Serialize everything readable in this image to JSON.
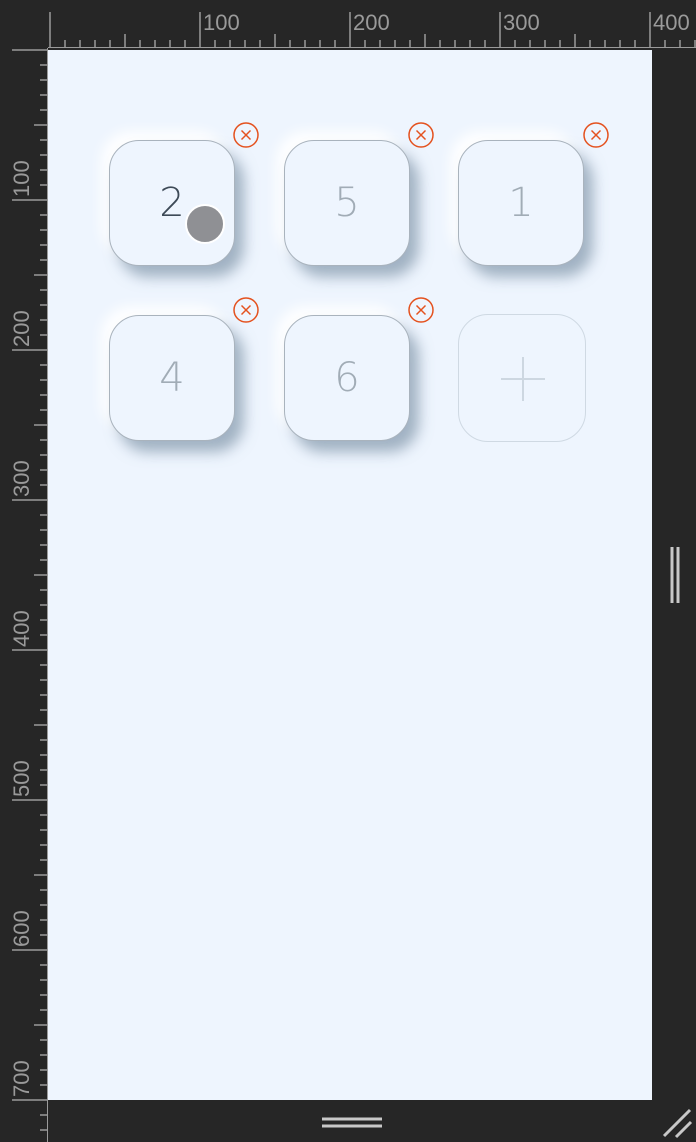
{
  "ruler": {
    "top_labels": [
      "100",
      "200",
      "300",
      "400"
    ],
    "left_labels": [
      "100",
      "200",
      "300",
      "400",
      "500",
      "600",
      "700"
    ]
  },
  "tiles": [
    {
      "number": "2",
      "removable": true,
      "active": true
    },
    {
      "number": "5",
      "removable": true,
      "active": false
    },
    {
      "number": "1",
      "removable": true,
      "active": false
    },
    {
      "number": "4",
      "removable": true,
      "active": false
    },
    {
      "number": "6",
      "removable": true,
      "active": false
    }
  ],
  "add_tile": {
    "icon": "plus-icon"
  },
  "icons": {
    "remove": "close-circle-icon",
    "resize_right": "vertical-grip-icon",
    "resize_bottom": "horizontal-grip-icon",
    "resize_corner": "resize-corner-icon"
  },
  "colors": {
    "canvas_background": "#eef5fe",
    "frame_background": "#262626",
    "remove_accent": "#e4521f",
    "active_number": "#3d4a57",
    "inactive_number": "#a1acb6",
    "touch_indicator": "#8f9094"
  }
}
